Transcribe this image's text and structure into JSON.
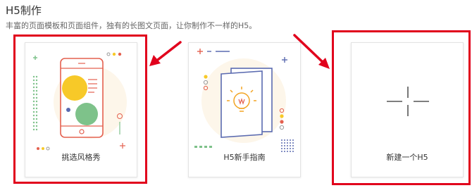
{
  "section": {
    "title": "H5制作",
    "subtitle": "丰富的页面模板和页面组件，独有的长图文页面，让你制作不一样的H5。"
  },
  "cards": [
    {
      "label": "挑选风格秀",
      "icon": "phone-template-illustration"
    },
    {
      "label": "H5新手指南",
      "icon": "lightbulb-book-illustration"
    },
    {
      "label": "新建一个H5",
      "icon": "plus-icon"
    }
  ],
  "colors": {
    "highlight": "#e1001c",
    "phone_frame": "#e4604f",
    "circle_yellow": "#f7c928",
    "circle_green": "#7ec28a",
    "book": "#5a6ab0",
    "bulb": "#f2a423",
    "plus": "#555555"
  }
}
